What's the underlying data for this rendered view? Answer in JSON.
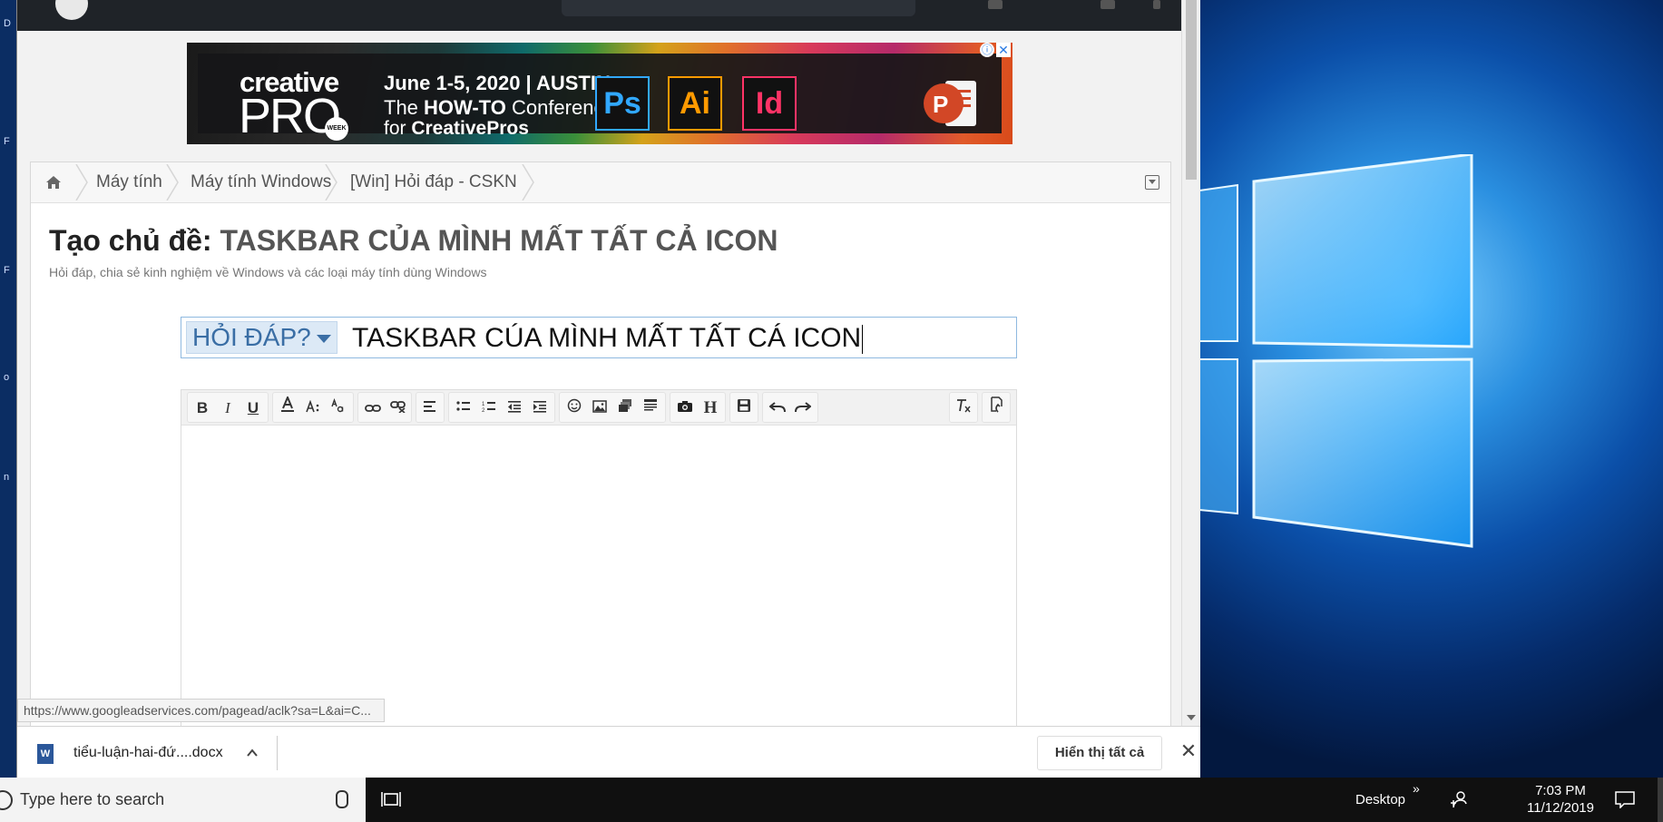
{
  "ad": {
    "brand_top": "creative",
    "brand_bottom": "PRO",
    "brand_badge": "WEEK",
    "line1": "June 1-5, 2020  |  AUSTIN",
    "line2_prefix": "The ",
    "line2_bold": "HOW-TO",
    "line2_suffix": " Conference",
    "line3_prefix": "for ",
    "line3_bold": "CreativePros",
    "apps": [
      {
        "label": "Ps",
        "color": "#31a8ff"
      },
      {
        "label": "Ai",
        "color": "#ff9a00"
      },
      {
        "label": "Id",
        "color": "#ff3366"
      }
    ],
    "info_glyph": "ⓘ",
    "close_glyph": "✕"
  },
  "breadcrumb": {
    "items": [
      "Máy tính",
      "Máy tính Windows",
      "[Win] Hỏi đáp - CSKN"
    ]
  },
  "page": {
    "title_prefix": "Tạo chủ đề: ",
    "title_topic": "TASKBAR CỦA MÌNH MẤT TẤT CẢ ICON",
    "subtitle": "Hỏi đáp, chia sẻ kinh nghiệm về Windows và các loại máy tính dùng Windows"
  },
  "thread_form": {
    "prefix_label": "HỎI ĐÁP?",
    "title_value": "TASKBAR CÚA MÌNH MẤT TẤT CÁ ICON"
  },
  "editor_toolbar": {
    "bold": "B",
    "italic": "I",
    "underline": "U",
    "heading": "H"
  },
  "status_url": "https://www.googleadservices.com/pagead/aclk?sa=L&ai=C...",
  "downloads": {
    "file_name": "tiểu-luận-hai-đứ....docx",
    "file_icon_letter": "W",
    "show_all": "Hiển thị tất cả",
    "close_glyph": "✕"
  },
  "taskbar": {
    "search_placeholder": "Type here to search",
    "desktop_label": "Desktop",
    "chevron": "»",
    "time": "7:03 PM",
    "date": "11/12/2019"
  },
  "colors": {
    "accent_blue": "#3a6ea5",
    "prefix_bg": "#dce9f6",
    "taskbar": "#101010"
  }
}
